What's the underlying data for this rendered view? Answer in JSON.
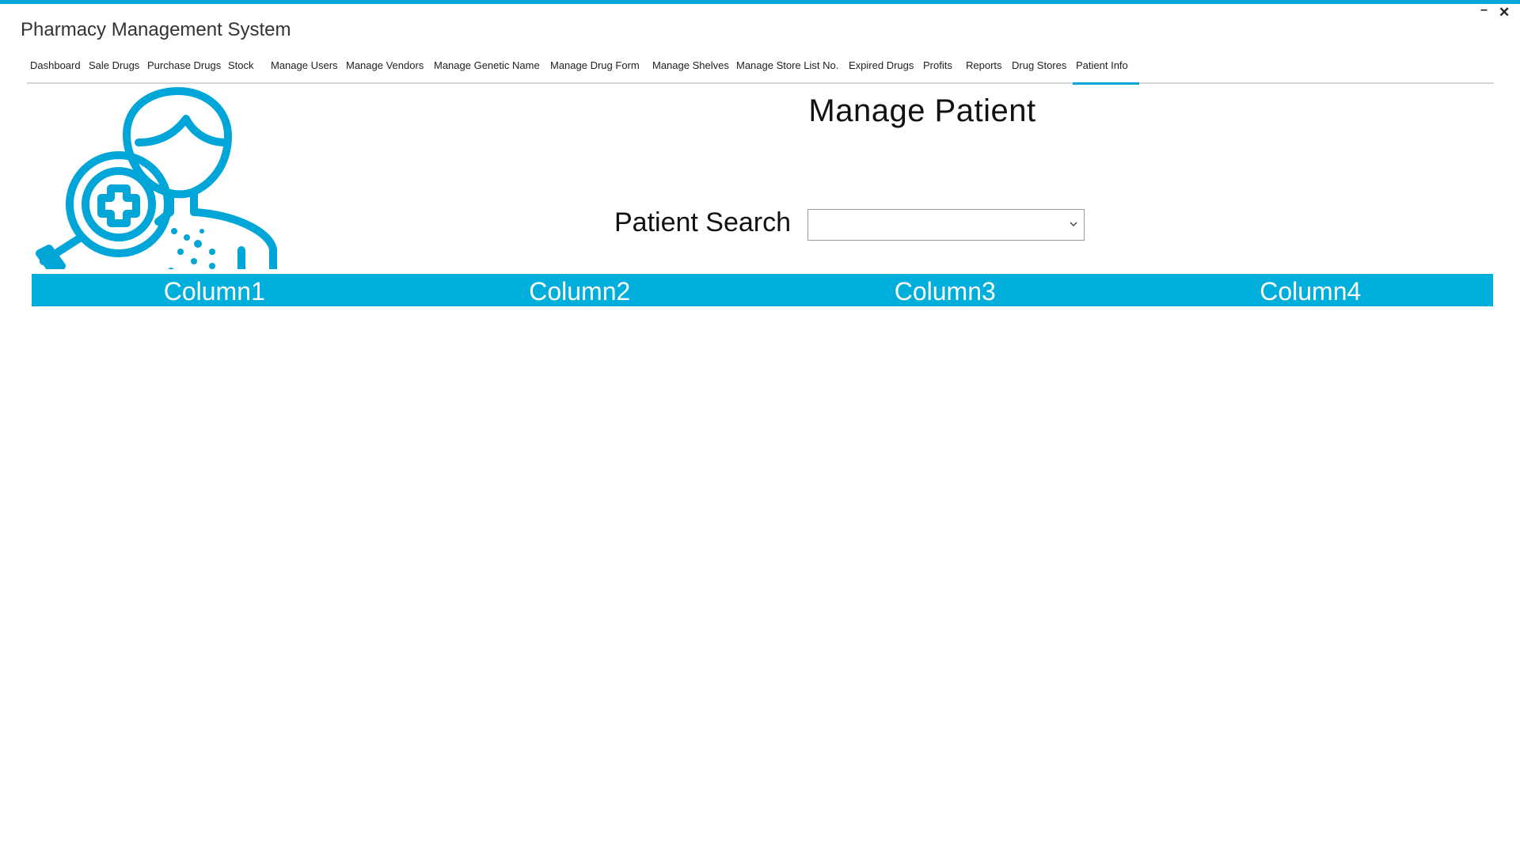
{
  "window": {
    "title": "Pharmacy Management System",
    "minimize_label": "–",
    "close_label": "✕",
    "accent_color": "#00a6d8"
  },
  "tabs": [
    {
      "label": "Dashboard"
    },
    {
      "label": "Sale Drugs"
    },
    {
      "label": "Purchase Drugs"
    },
    {
      "label": "Stock"
    },
    {
      "label": "Manage Users"
    },
    {
      "label": "Manage Vendors"
    },
    {
      "label": "Manage Genetic Name"
    },
    {
      "label": "Manage Drug Form"
    },
    {
      "label": "Manage Shelves"
    },
    {
      "label": "Manage Store List No."
    },
    {
      "label": "Expired Drugs"
    },
    {
      "label": "Profits"
    },
    {
      "label": "Reports"
    },
    {
      "label": "Drug Stores"
    },
    {
      "label": "Patient Info",
      "active": true
    }
  ],
  "main": {
    "logo_icon": "patient-search-icon",
    "page_title": "Manage Patient",
    "search_label": "Patient Search",
    "search_value": "",
    "table_header_color": "#00aedb",
    "columns": [
      "Column1",
      "Column2",
      "Column3",
      "Column4"
    ]
  }
}
